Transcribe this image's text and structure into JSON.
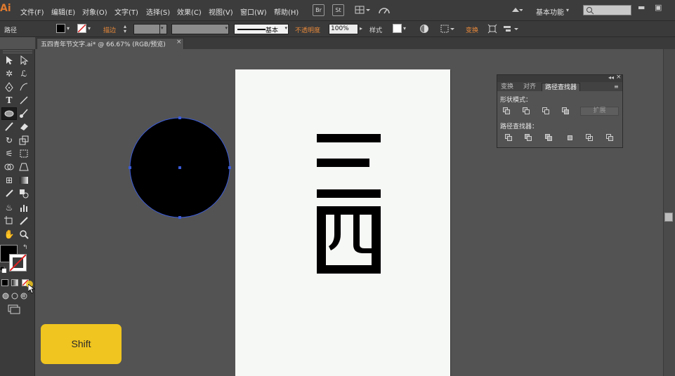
{
  "app": {
    "logo": "Ai"
  },
  "menu": {
    "items": [
      "文件(F)",
      "编辑(E)",
      "对象(O)",
      "文字(T)",
      "选择(S)",
      "效果(C)",
      "视图(V)",
      "窗口(W)",
      "帮助(H)"
    ],
    "buttons": [
      "Br",
      "St"
    ],
    "workspace": "基本功能",
    "search_placeholder": ""
  },
  "control_bar": {
    "mode_label": "路径",
    "stroke_label": "描边",
    "stroke_style": "基本",
    "opacity_label": "不透明度",
    "opacity_value": "100%",
    "style_label": "样式",
    "transform_label": "变换"
  },
  "document": {
    "tab_title": "五四青年节文字.ai* @ 66.67% (RGB/预览)",
    "tab_close": "×"
  },
  "pathfinder_panel": {
    "tabs": [
      "变换",
      "对齐",
      "路径查找器"
    ],
    "active_tab": "路径查找器",
    "shape_modes_label": "形状模式：",
    "pathfinders_label": "路径查找器：",
    "expand_button": "扩展"
  },
  "overlay": {
    "key_label": "Shift"
  },
  "colors": {
    "accent_orange": "#e8893a",
    "shift_key": "#f0c51f",
    "selection": "#3b5bd6"
  },
  "icons": {
    "tools": [
      "selection-tool",
      "direct-selection-tool",
      "magic-wand-tool",
      "lasso-tool",
      "pen-tool",
      "curvature-tool",
      "type-tool",
      "line-tool",
      "ellipse-tool",
      "paintbrush-tool",
      "pencil-tool",
      "eraser-tool",
      "rotate-tool",
      "scale-tool",
      "width-tool",
      "free-transform-tool",
      "shape-builder-tool",
      "perspective-tool",
      "mesh-tool",
      "gradient-tool",
      "eyedropper-tool",
      "blend-tool",
      "symbol-sprayer-tool",
      "column-graph-tool",
      "artboard-tool",
      "slice-tool",
      "hand-tool",
      "zoom-tool"
    ]
  }
}
